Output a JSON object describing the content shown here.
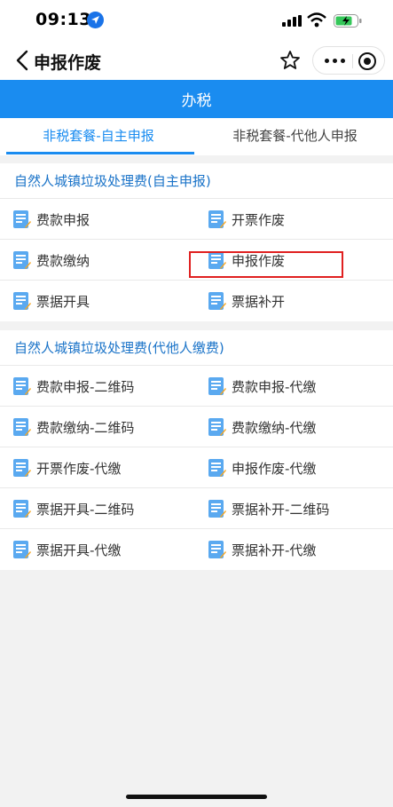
{
  "status_bar": {
    "time": "09:13"
  },
  "nav": {
    "title": "申报作废"
  },
  "banner": {
    "title": "办税"
  },
  "tabs": [
    {
      "label": "非税套餐-自主申报",
      "active": true
    },
    {
      "label": "非税套餐-代他人申报",
      "active": false
    }
  ],
  "sections": [
    {
      "title": "自然人城镇垃圾处理费(自主申报)",
      "items": [
        "费款申报",
        "开票作废",
        "费款缴纳",
        "申报作废",
        "票据开具",
        "票据补开"
      ]
    },
    {
      "title": "自然人城镇垃圾处理费(代他人缴费)",
      "items": [
        "费款申报-二维码",
        "费款申报-代缴",
        "费款缴纳-二维码",
        "费款缴纳-代缴",
        "开票作废-代缴",
        "申报作废-代缴",
        "票据开具-二维码",
        "票据补开-二维码",
        "票据开具-代缴",
        "票据补开-代缴"
      ]
    }
  ],
  "colors": {
    "accent": "#1a8cf0",
    "section_title": "#1a73c8",
    "highlight": "#e02020"
  },
  "icons": [
    "location-arrow-icon",
    "signal-icon",
    "wifi-icon",
    "battery-charging-icon",
    "back-chevron-icon",
    "star-outline-icon",
    "more-dots-icon",
    "close-target-icon",
    "document-edit-icon"
  ]
}
